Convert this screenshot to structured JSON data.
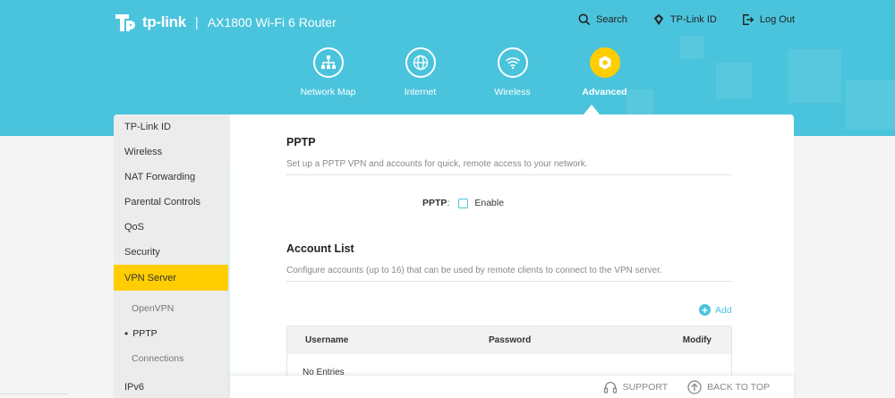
{
  "header": {
    "brand": "tp-link",
    "separator": "|",
    "model": "AX1800 Wi-Fi 6 Router",
    "accent_color": "#4ac4dc",
    "active_color": "#ffcd00"
  },
  "topnav": {
    "search": "Search",
    "tplink_id": "TP-Link ID",
    "logout": "Log Out"
  },
  "mainnav": [
    {
      "label": "Network Map",
      "icon": "network-map-icon"
    },
    {
      "label": "Internet",
      "icon": "globe-icon"
    },
    {
      "label": "Wireless",
      "icon": "wifi-icon"
    },
    {
      "label": "Advanced",
      "icon": "gear-icon",
      "active": true
    }
  ],
  "sidebar": {
    "items": [
      "TP-Link ID",
      "Wireless",
      "NAT Forwarding",
      "Parental Controls",
      "QoS",
      "Security",
      "VPN Server"
    ],
    "active": "VPN Server",
    "sub_items": [
      "OpenVPN",
      "PPTP",
      "Connections"
    ],
    "current_sub": "PPTP",
    "next_item": "IPv6"
  },
  "pptp_section": {
    "title": "PPTP",
    "description": "Set up a PPTP VPN and accounts for quick, remote access to your network.",
    "field_label": "PPTP",
    "field_colon": ":",
    "checkbox_label": "Enable",
    "checked": false
  },
  "accounts_section": {
    "title": "Account List",
    "description": "Configure accounts (up to 16) that can be used by remote clients to connect to the VPN server.",
    "add_label": "Add",
    "columns": [
      "Username",
      "Password",
      "Modify"
    ],
    "empty_text": "No Entries"
  },
  "footer": {
    "support": "SUPPORT",
    "back_to_top": "BACK TO TOP"
  }
}
